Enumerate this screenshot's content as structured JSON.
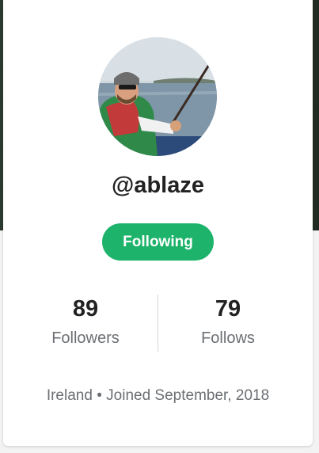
{
  "profile": {
    "handle": "@ablaze",
    "follow_button_label": "Following",
    "stats": {
      "followers_count": "89",
      "followers_label": "Followers",
      "follows_count": "79",
      "follows_label": "Follows"
    },
    "location": "Ireland",
    "separator": "•",
    "joined": "Joined September, 2018"
  },
  "colors": {
    "accent": "#1db36a",
    "text_primary": "#222222",
    "text_secondary": "#6b6f73"
  }
}
